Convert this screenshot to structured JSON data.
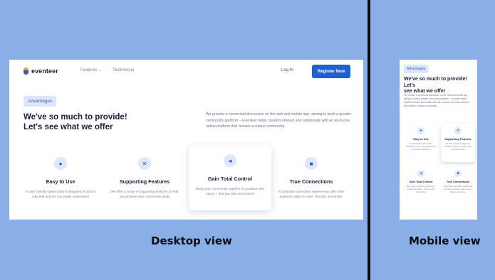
{
  "desktop": {
    "logo": "eventeer",
    "nav": {
      "features": "Features",
      "testimonial": "Testimonial",
      "login": "Log In",
      "register": "Register Now"
    },
    "badge": "Advantages",
    "heading_line1": "We've so much to provide!",
    "heading_line2": "Let's see what we offer",
    "description": "We provide a communal discussion on the web and mobile app, aiming to build a greater community platform – Eventeer helps creators interact and collaborate with an all-in-one online platform that creates a unique community.",
    "cards": [
      {
        "icon": "users-icon",
        "title": "Easy to Use",
        "text": "A user friendly system that is designed in such a way that anyone can easily understand"
      },
      {
        "icon": "tools-icon",
        "title": "Supporting Features",
        "text": "We offer a range of supporting features to help you achieve your community goals"
      },
      {
        "icon": "megaphone-icon",
        "title": "Gain Total Control",
        "text": "Bring your community together in a unique safe space – that you own and control"
      },
      {
        "icon": "chat-icon",
        "title": "True Connections",
        "text": "Go beyond connection experiences with more authentic ways to meet, discuss, and share."
      }
    ]
  },
  "mobile": {
    "badge": "Advantages",
    "heading_line1": "We've so much to provide! Let's",
    "heading_line2": "see what we offer",
    "description": "We provide a communal discussion on the web and mobile app, aiming to build a greater community platform – Eventeer helps creators interact and collaborate with an all-in-one online platform that creates a unique community.",
    "cards": [
      {
        "title": "Easy to Use",
        "text": "A user friendly system that is designed in such a way that anyone can easily understand"
      },
      {
        "title": "Supporting Features",
        "text": "We offer a range of supporting features to help you achieve your community goals"
      },
      {
        "title": "Gain Total Control",
        "text": "Bring your community together in a unique safe space – that you own and control"
      },
      {
        "title": "True Connections",
        "text": "Go beyond connection experiences with more authentic ways to meet, discuss, and share."
      }
    ]
  },
  "captions": {
    "desktop": "Desktop view",
    "mobile": "Mobile view"
  },
  "colors": {
    "background": "#8aaee6",
    "primary": "#1f5fd6",
    "badge_bg": "#dce6fb"
  }
}
